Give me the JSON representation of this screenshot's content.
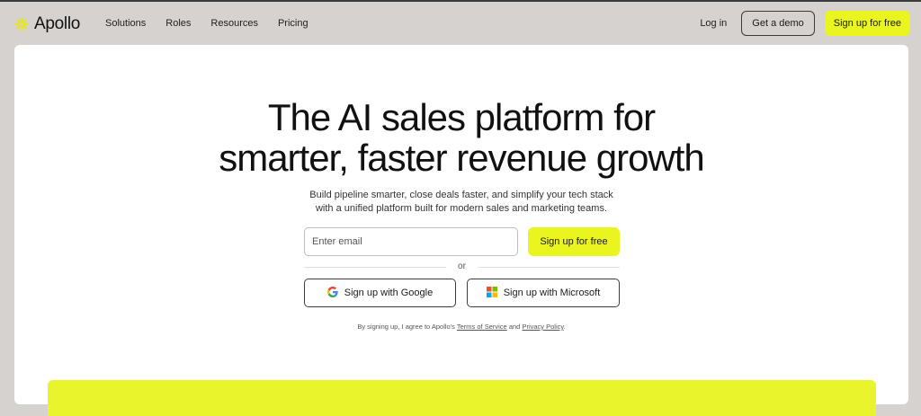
{
  "nav": {
    "logo_text": "Apollo",
    "links": [
      "Solutions",
      "Roles",
      "Resources",
      "Pricing"
    ],
    "login": "Log in",
    "demo": "Get a demo",
    "signup": "Sign up for free"
  },
  "hero": {
    "headline_line1": "The AI sales platform for",
    "headline_line2": "smarter, faster revenue growth",
    "sub_line1": "Build pipeline smarter, close deals faster, and simplify your tech stack",
    "sub_line2": "with a unified platform built for modern sales and marketing teams.",
    "email_placeholder": "Enter email",
    "signup_button": "Sign up for free",
    "or": "or",
    "google_button": "Sign up with Google",
    "microsoft_button": "Sign up with Microsoft",
    "legal_prefix": "By signing up, I agree to Apollo's",
    "terms": "Terms of Service",
    "and": "and",
    "privacy": "Privacy Policy",
    "period": "."
  },
  "colors": {
    "accent": "#eaf41f",
    "background": "#d5d2cf",
    "card": "#ffffff"
  },
  "icons": {
    "logo": "apollo-sunburst-icon",
    "google": "google-g-icon",
    "microsoft": "microsoft-squares-icon"
  }
}
